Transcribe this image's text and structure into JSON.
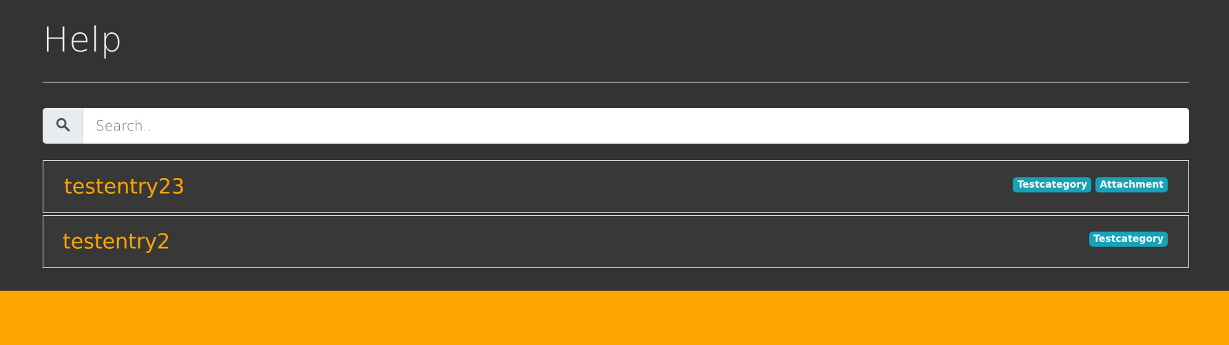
{
  "page": {
    "title": "Help"
  },
  "search": {
    "placeholder": "Search.."
  },
  "entries": [
    {
      "title": "testentry23",
      "badges": [
        "Testcategory",
        "Attachment"
      ]
    },
    {
      "title": "testentry2",
      "badges": [
        "Testcategory"
      ]
    }
  ],
  "colors": {
    "background": "#333333",
    "accent": "#ffa500",
    "badge": "#17a2b8",
    "footer": "#ffa500"
  },
  "icons": {
    "search": "search-icon"
  }
}
